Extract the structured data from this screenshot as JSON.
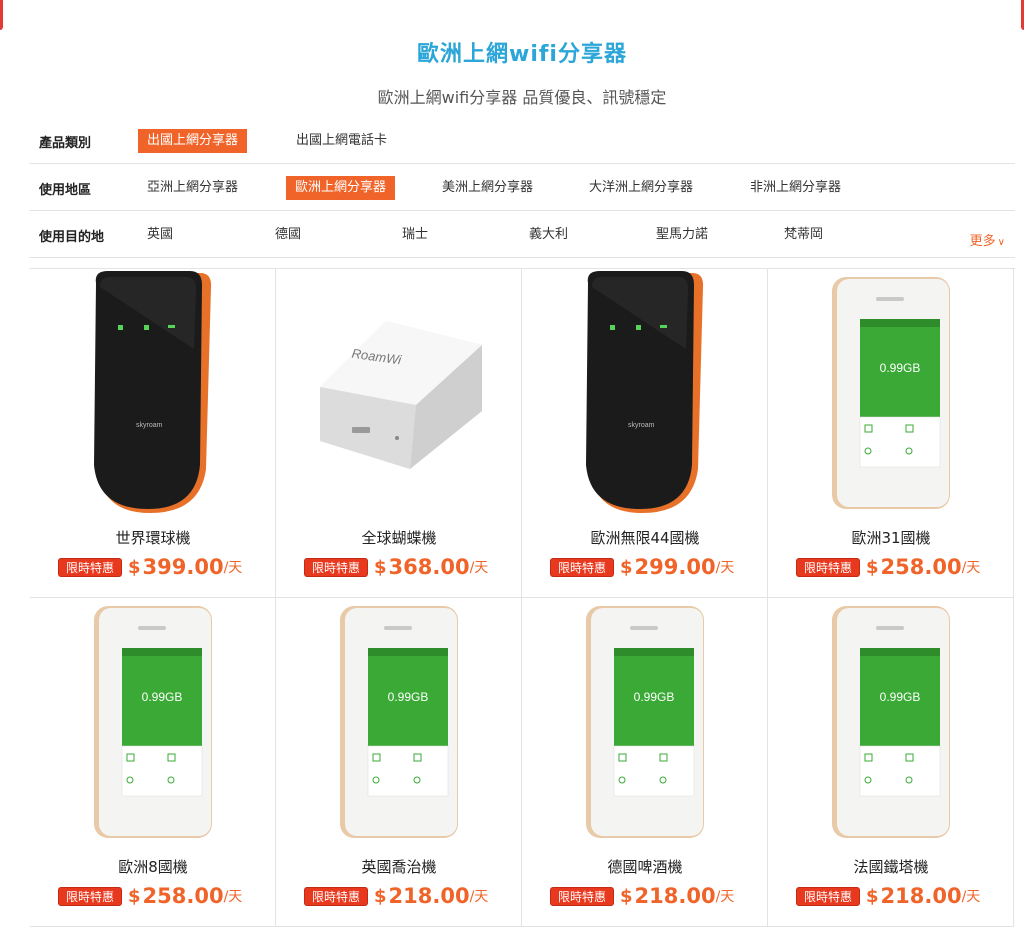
{
  "page": {
    "title": "歐洲上網wifi分享器",
    "subtitle": "歐洲上網wifi分享器 品質優良、訊號穩定"
  },
  "filters": [
    {
      "label": "產品類別",
      "options": [
        {
          "text": "出國上網分享器",
          "active": true
        },
        {
          "text": "出國上網電話卡",
          "active": false
        }
      ]
    },
    {
      "label": "使用地區",
      "options": [
        {
          "text": "亞洲上網分享器",
          "active": false
        },
        {
          "text": "歐洲上網分享器",
          "active": true
        },
        {
          "text": "美洲上網分享器",
          "active": false
        },
        {
          "text": "大洋洲上網分享器",
          "active": false
        },
        {
          "text": "非洲上網分享器",
          "active": false
        }
      ]
    },
    {
      "label": "使用目的地",
      "options": [
        {
          "text": "英國",
          "active": false
        },
        {
          "text": "德國",
          "active": false
        },
        {
          "text": "瑞士",
          "active": false
        },
        {
          "text": "義大利",
          "active": false
        },
        {
          "text": "聖馬力諾",
          "active": false
        },
        {
          "text": "梵蒂岡",
          "active": false
        }
      ],
      "more_label": "更多"
    }
  ],
  "products": [
    {
      "name": "世界環球機",
      "badge": "限時特惠",
      "currency": "$",
      "price": "399.00",
      "unit": "/天",
      "image": "skyroam-black-icon",
      "device_brand": "skyroam"
    },
    {
      "name": "全球蝴蝶機",
      "badge": "限時特惠",
      "currency": "$",
      "price": "368.00",
      "unit": "/天",
      "image": "roamwifi-white-box-icon",
      "device_brand": "RoamWi"
    },
    {
      "name": "歐洲無限44國機",
      "badge": "限時特惠",
      "currency": "$",
      "price": "299.00",
      "unit": "/天",
      "image": "skyroam-black-icon",
      "device_brand": "skyroam"
    },
    {
      "name": "歐洲31國機",
      "badge": "限時特惠",
      "currency": "$",
      "price": "258.00",
      "unit": "/天",
      "image": "touchscreen-router-icon",
      "screen_value": "0.99GB"
    },
    {
      "name": "歐洲8國機",
      "badge": "限時特惠",
      "currency": "$",
      "price": "258.00",
      "unit": "/天",
      "image": "touchscreen-router-icon",
      "screen_value": "0.99GB"
    },
    {
      "name": "英國喬治機",
      "badge": "限時特惠",
      "currency": "$",
      "price": "218.00",
      "unit": "/天",
      "image": "touchscreen-router-icon",
      "screen_value": "0.99GB"
    },
    {
      "name": "德國啤酒機",
      "badge": "限時特惠",
      "currency": "$",
      "price": "218.00",
      "unit": "/天",
      "image": "touchscreen-router-icon",
      "screen_value": "0.99GB"
    },
    {
      "name": "法國鐵塔機",
      "badge": "限時特惠",
      "currency": "$",
      "price": "218.00",
      "unit": "/天",
      "image": "touchscreen-router-icon",
      "screen_value": "0.99GB"
    }
  ],
  "colors": {
    "title": "#2ca6d8",
    "accent": "#f0642a",
    "badge": "#e8381e",
    "screen_green": "#3aa935"
  }
}
